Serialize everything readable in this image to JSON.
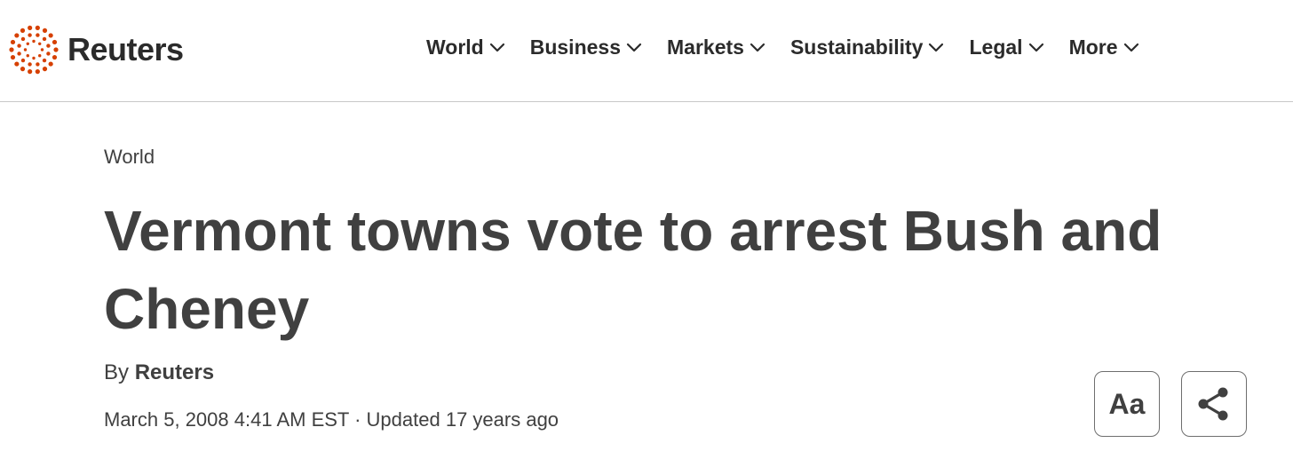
{
  "header": {
    "logo_text": "Reuters",
    "brand_color": "#d64000",
    "nav": [
      {
        "label": "World",
        "icon": "chevron-down-icon"
      },
      {
        "label": "Business",
        "icon": "chevron-down-icon"
      },
      {
        "label": "Markets",
        "icon": "chevron-down-icon"
      },
      {
        "label": "Sustainability",
        "icon": "chevron-down-icon"
      },
      {
        "label": "Legal",
        "icon": "chevron-down-icon"
      },
      {
        "label": "More",
        "icon": "chevron-down-icon"
      }
    ]
  },
  "article": {
    "section": "World",
    "headline": "Vermont towns vote to arrest Bush and Cheney",
    "byline_prefix": "By",
    "author": "Reuters",
    "date": "March 5, 2008 4:41 AM EST",
    "separator": "·",
    "updated": "Updated 17 years ago"
  },
  "tools": {
    "font_size_label": "Aa",
    "share_icon": "share-icon"
  }
}
